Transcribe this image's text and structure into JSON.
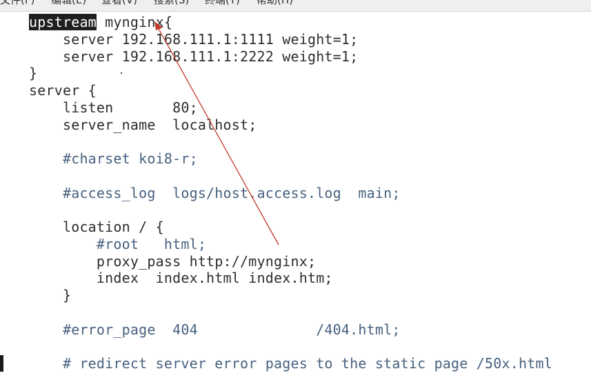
{
  "menu": [
    {
      "label": "文件(F)"
    },
    {
      "label": "编辑(E)"
    },
    {
      "label": "查看(V)"
    },
    {
      "label": "搜索(S)"
    },
    {
      "label": "终端(T)"
    },
    {
      "label": "帮助(H)"
    }
  ],
  "code": {
    "l1_keyword": "upstream",
    "l1_rest": " mynginx{",
    "l2": "    server 192.168.111.1:1111 weight=1;",
    "l3": "    server 192.168.111.1:2222 weight=1;",
    "l4": "}",
    "l5": "server {",
    "l6": "    listen       80;",
    "l7": "    server_name  localhost;",
    "l8": "    #charset koi8-r;",
    "l9": "    #access_log  logs/host.access.log  main;",
    "l10": "    location / {",
    "l11": "        #root   html;",
    "l12": "        proxy_pass http://mynginx;",
    "l13": "        index  index.html index.htm;",
    "l14": "    }",
    "l15": "    #error_page  404              /404.html;",
    "l16": "    # redirect server error pages to the static page /50x.html"
  },
  "colors": {
    "annotation_arrow": "#c0392b",
    "comment": "#47617e",
    "text": "#2d2d2d"
  }
}
